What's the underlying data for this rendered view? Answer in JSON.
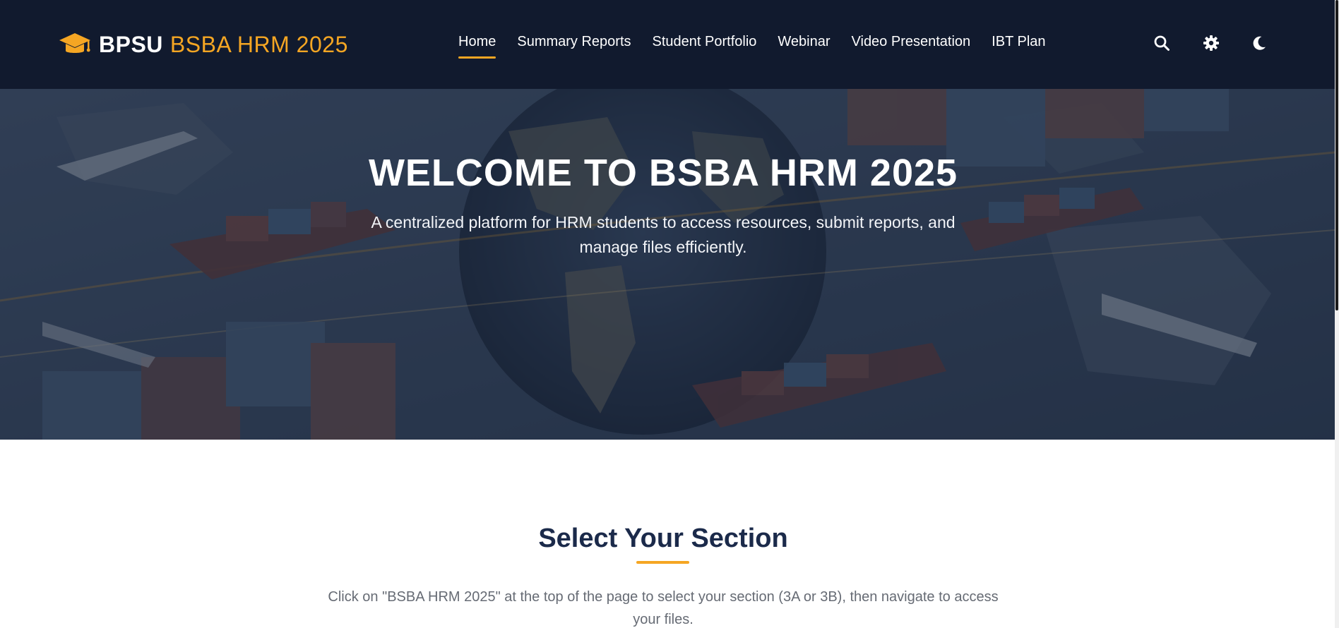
{
  "brand": {
    "strong": "BPSU",
    "accent": "BSBA HRM 2025",
    "icon": "graduation-cap-icon"
  },
  "nav": {
    "items": [
      {
        "label": "Home",
        "active": true
      },
      {
        "label": "Summary Reports",
        "active": false
      },
      {
        "label": "Student Portfolio",
        "active": false
      },
      {
        "label": "Webinar",
        "active": false
      },
      {
        "label": "Video Presentation",
        "active": false
      },
      {
        "label": "IBT Plan",
        "active": false
      }
    ],
    "icons": [
      "search-icon",
      "gear-icon",
      "moon-icon"
    ]
  },
  "hero": {
    "title": "WELCOME TO BSBA HRM 2025",
    "subtitle": "A centralized platform for HRM students to access resources, submit reports, and manage files efficiently."
  },
  "section": {
    "title": "Select Your Section",
    "description": "Click on \"BSBA HRM 2025\" at the top of the page to select your section (3A or 3B), then navigate to access your files."
  },
  "colors": {
    "navbar_bg": "#111a2e",
    "accent": "#f5a623",
    "heading": "#1b2a4a",
    "muted_text": "#666b74"
  }
}
